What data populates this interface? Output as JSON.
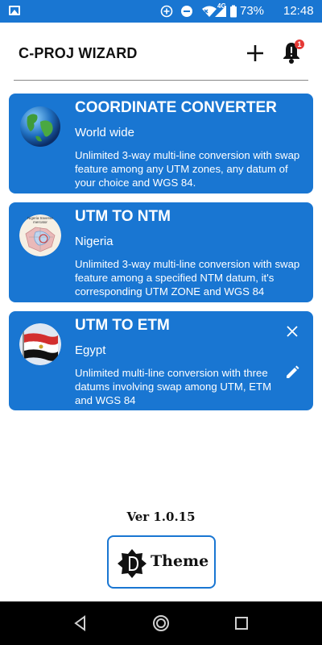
{
  "status_bar": {
    "network_label": "4G",
    "battery": "73%",
    "time": "12:48",
    "icons": [
      "image-icon",
      "plus-circle-icon",
      "do-not-disturb-icon",
      "wifi-icon",
      "signal-icon",
      "battery-icon"
    ]
  },
  "header": {
    "title": "C-PROJ WIZARD",
    "notification_count": "1"
  },
  "cards": [
    {
      "title": "COORDINATE CONVERTER",
      "subtitle": "World wide",
      "description": "Unlimited 3-way multi-line conversion with swap feature among any UTM zones, any datum of your choice and WGS 84.",
      "icon": "globe-icon"
    },
    {
      "title": "UTM TO NTM",
      "subtitle": "Nigeria",
      "description": "Unlimited 3-way multi-line conversion with swap feature among a specified NTM datum, it's corresponding UTM ZONE and WGS 84",
      "icon": "nigeria-map-icon",
      "avatar_caption": "Nigeria traverse mercator"
    },
    {
      "title": "UTM TO ETM",
      "subtitle": "Egypt",
      "description": "Unlimited multi-line conversion with three datums involving swap among UTM, ETM and WGS 84",
      "icon": "egypt-flag-icon"
    }
  ],
  "footer": {
    "version": "Ver 1.0.15",
    "theme_label": "Theme"
  },
  "colors": {
    "primary": "#1976d2",
    "badge": "#e53935",
    "navbar": "#000000"
  }
}
